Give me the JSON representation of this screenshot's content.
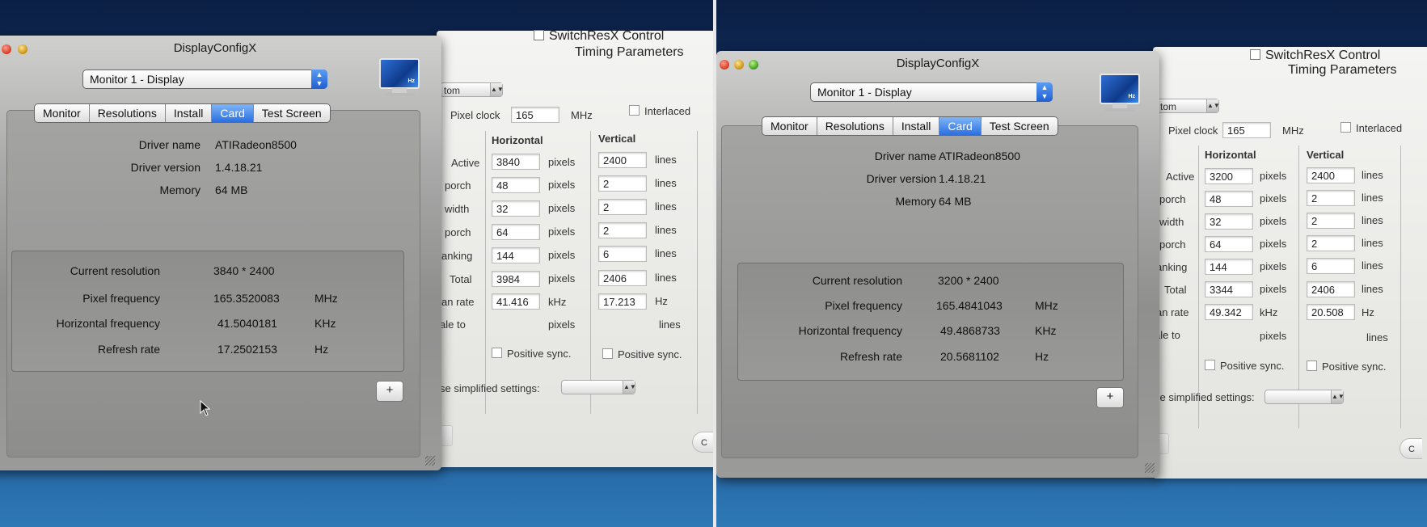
{
  "left": {
    "switchresx": {
      "title": "SwitchResX Control",
      "subtitle": "Timing Parameters",
      "custom_select": "tom",
      "pixel_clock_label": "Pixel clock",
      "pixel_clock_value": "165",
      "pixel_clock_unit": "MHz",
      "interlaced_label": "Interlaced",
      "horizontal_header": "Horizontal",
      "vertical_header": "Vertical",
      "rows": [
        {
          "label": "Active",
          "h": "3840",
          "h_unit": "pixels",
          "v": "2400",
          "v_unit": "lines"
        },
        {
          "label": "porch",
          "h": "48",
          "h_unit": "pixels",
          "v": "2",
          "v_unit": "lines"
        },
        {
          "label": "width",
          "h": "32",
          "h_unit": "pixels",
          "v": "2",
          "v_unit": "lines"
        },
        {
          "label": "porch",
          "h": "64",
          "h_unit": "pixels",
          "v": "2",
          "v_unit": "lines"
        },
        {
          "label": "anking",
          "h": "144",
          "h_unit": "pixels",
          "v": "6",
          "v_unit": "lines"
        },
        {
          "label": "Total",
          "h": "3984",
          "h_unit": "pixels",
          "v": "2406",
          "v_unit": "lines"
        },
        {
          "label": "an rate",
          "h": "41.416",
          "h_unit": "kHz",
          "v": "17.213",
          "v_unit": "Hz"
        },
        {
          "label": "ale to",
          "h": "",
          "h_unit": "pixels",
          "v": "",
          "v_unit": "lines"
        }
      ],
      "positive_sync_label": "Positive sync.",
      "simplified_label": "se simplified settings:",
      "bottom_button_label": "C"
    },
    "dcx": {
      "title": "DisplayConfigX",
      "monitor_select": "Monitor 1 - Display",
      "hz_label": "Hz",
      "tabs": [
        "Monitor",
        "Resolutions",
        "Install",
        "Card",
        "Test Screen"
      ],
      "driver": [
        {
          "label": "Driver name",
          "value": "ATIRadeon8500"
        },
        {
          "label": "Driver version",
          "value": "1.4.18.21"
        },
        {
          "label": "Memory",
          "value": "64 MB"
        }
      ],
      "stats": [
        {
          "label": "Current resolution",
          "value": "3840 * 2400",
          "unit": ""
        },
        {
          "label": "Pixel frequency",
          "value": "165.3520083",
          "unit": "MHz"
        },
        {
          "label": "Horizontal frequency",
          "value": "41.5040181",
          "unit": "KHz"
        },
        {
          "label": "Refresh rate",
          "value": "17.2502153",
          "unit": "Hz"
        }
      ],
      "plus_label": "+"
    }
  },
  "right": {
    "switchresx": {
      "title": "SwitchResX Control",
      "subtitle": "Timing Parameters",
      "custom_select": "tom",
      "pixel_clock_label": "Pixel clock",
      "pixel_clock_value": "165",
      "pixel_clock_unit": "MHz",
      "interlaced_label": "Interlaced",
      "horizontal_header": "Horizontal",
      "vertical_header": "Vertical",
      "rows": [
        {
          "label": "Active",
          "h": "3200",
          "h_unit": "pixels",
          "v": "2400",
          "v_unit": "lines"
        },
        {
          "label": "porch",
          "h": "48",
          "h_unit": "pixels",
          "v": "2",
          "v_unit": "lines"
        },
        {
          "label": "width",
          "h": "32",
          "h_unit": "pixels",
          "v": "2",
          "v_unit": "lines"
        },
        {
          "label": "porch",
          "h": "64",
          "h_unit": "pixels",
          "v": "2",
          "v_unit": "lines"
        },
        {
          "label": "anking",
          "h": "144",
          "h_unit": "pixels",
          "v": "6",
          "v_unit": "lines"
        },
        {
          "label": "Total",
          "h": "3344",
          "h_unit": "pixels",
          "v": "2406",
          "v_unit": "lines"
        },
        {
          "label": "an rate",
          "h": "49.342",
          "h_unit": "kHz",
          "v": "20.508",
          "v_unit": "Hz"
        },
        {
          "label": "ale to",
          "h": "",
          "h_unit": "pixels",
          "v": "",
          "v_unit": "lines"
        }
      ],
      "positive_sync_label": "Positive sync.",
      "simplified_label": "se simplified settings:",
      "bottom_button_label": "C"
    },
    "dcx": {
      "title": "DisplayConfigX",
      "monitor_select": "Monitor 1 - Display",
      "hz_label": "Hz",
      "tabs": [
        "Monitor",
        "Resolutions",
        "Install",
        "Card",
        "Test Screen"
      ],
      "driver": [
        {
          "label": "Driver name",
          "value": "ATIRadeon8500"
        },
        {
          "label": "Driver version",
          "value": "1.4.18.21"
        },
        {
          "label": "Memory",
          "value": "64 MB"
        }
      ],
      "stats": [
        {
          "label": "Current resolution",
          "value": "3200 * 2400",
          "unit": ""
        },
        {
          "label": "Pixel frequency",
          "value": "165.4841043",
          "unit": "MHz"
        },
        {
          "label": "Horizontal frequency",
          "value": "49.4868733",
          "unit": "KHz"
        },
        {
          "label": "Refresh rate",
          "value": "20.5681102",
          "unit": "Hz"
        }
      ],
      "plus_label": "+"
    }
  }
}
